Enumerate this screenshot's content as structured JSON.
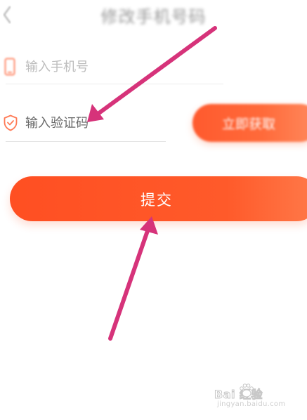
{
  "header": {
    "title": "修改手机号码"
  },
  "phone_field": {
    "placeholder": "输入手机号"
  },
  "code_field": {
    "placeholder": "输入验证码"
  },
  "get_code_button": {
    "label": "立即获取"
  },
  "submit_button": {
    "label": "提交"
  },
  "watermark": {
    "brand": "Bai  经验",
    "url": "jingyan.baidu.com"
  },
  "colors": {
    "accent": "#ff5a2a",
    "arrow": "#d6337a",
    "placeholder": "#bdbdbd",
    "divider": "#ececec"
  },
  "icons": [
    "back-icon",
    "phone-icon",
    "shield-icon",
    "paw-icon"
  ]
}
